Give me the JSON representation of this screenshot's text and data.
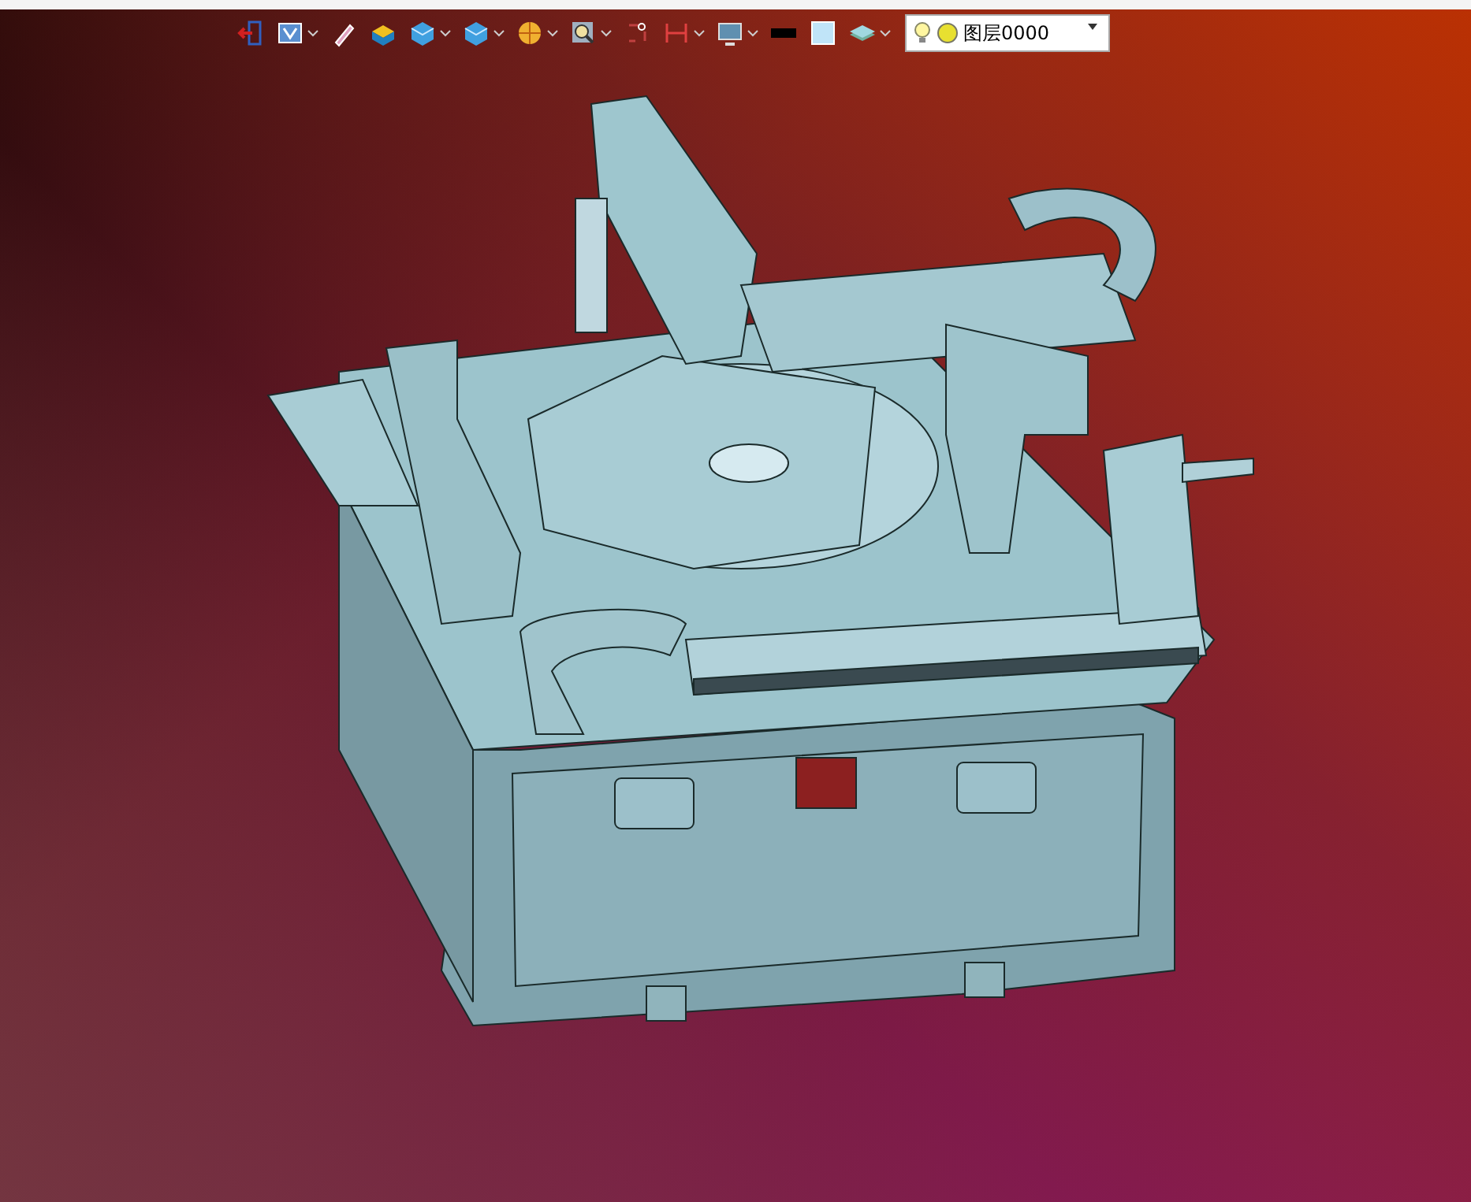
{
  "toolbar": [
    {
      "menu": false
    },
    {
      "menu": true
    },
    {
      "menu": false
    },
    {
      "menu": false
    },
    {
      "menu": true
    },
    {
      "menu": true
    },
    {
      "menu": true
    },
    {
      "menu": true
    },
    {
      "menu": false
    },
    {
      "menu": true
    },
    {
      "menu": true
    },
    {
      "menu": false
    },
    {
      "menu": false
    },
    {
      "menu": true
    }
  ],
  "layer_dropdown": {
    "value": "图层0000"
  }
}
